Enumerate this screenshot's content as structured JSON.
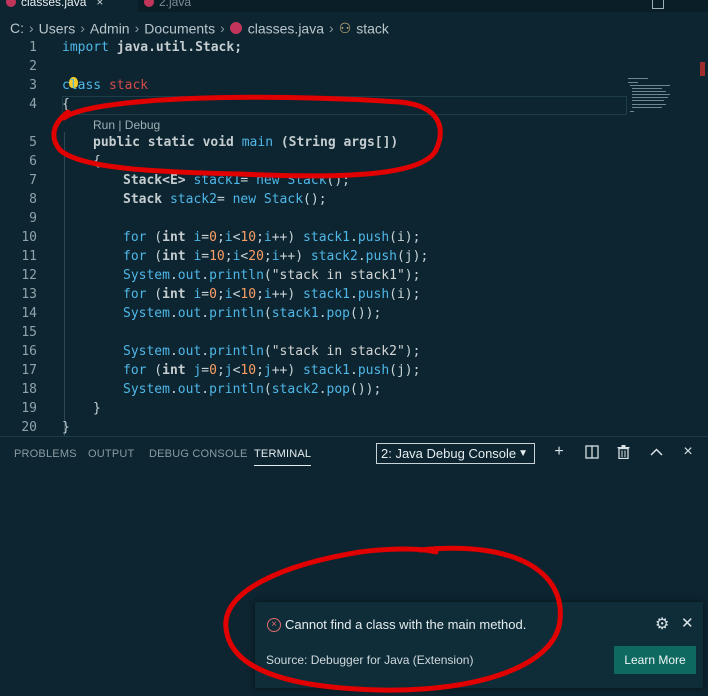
{
  "tabs": [
    {
      "label": "classes.java",
      "active": true,
      "close": "×"
    },
    {
      "label": "2.java",
      "active": false
    }
  ],
  "breadcrumb": {
    "drive": "C:",
    "items": [
      "Users",
      "Admin",
      "Documents",
      "classes.java",
      "stack"
    ]
  },
  "editor": {
    "code_lens": "Run | Debug",
    "lines": [
      {
        "n": "1"
      },
      {
        "n": "2"
      },
      {
        "n": "3"
      },
      {
        "n": "4"
      },
      {
        "n": "5"
      },
      {
        "n": "6"
      },
      {
        "n": "7"
      },
      {
        "n": "8"
      },
      {
        "n": "9"
      },
      {
        "n": "10"
      },
      {
        "n": "11"
      },
      {
        "n": "12"
      },
      {
        "n": "13"
      },
      {
        "n": "14"
      },
      {
        "n": "15"
      },
      {
        "n": "16"
      },
      {
        "n": "17"
      },
      {
        "n": "18"
      },
      {
        "n": "19"
      },
      {
        "n": "20"
      }
    ]
  },
  "panel": {
    "tabs": [
      "PROBLEMS",
      "OUTPUT",
      "DEBUG CONSOLE",
      "TERMINAL"
    ],
    "active_tab": "TERMINAL",
    "terminal_select": "2: Java Debug Console",
    "buttons": {
      "add": "+",
      "split": "split",
      "trash": "trash",
      "maximize": "^",
      "close": "×"
    }
  },
  "notification": {
    "message": "Cannot find a class with the main method.",
    "source": "Source: Debugger for Java (Extension)",
    "action": "Learn More",
    "icon": "error-circle-icon"
  },
  "colors": {
    "background": "#0c2530",
    "keyword": "#4fb7e8",
    "class_name": "#d44a4a",
    "number": "#ff9e64",
    "annotation": "#e00000",
    "button": "#0e6a60"
  }
}
